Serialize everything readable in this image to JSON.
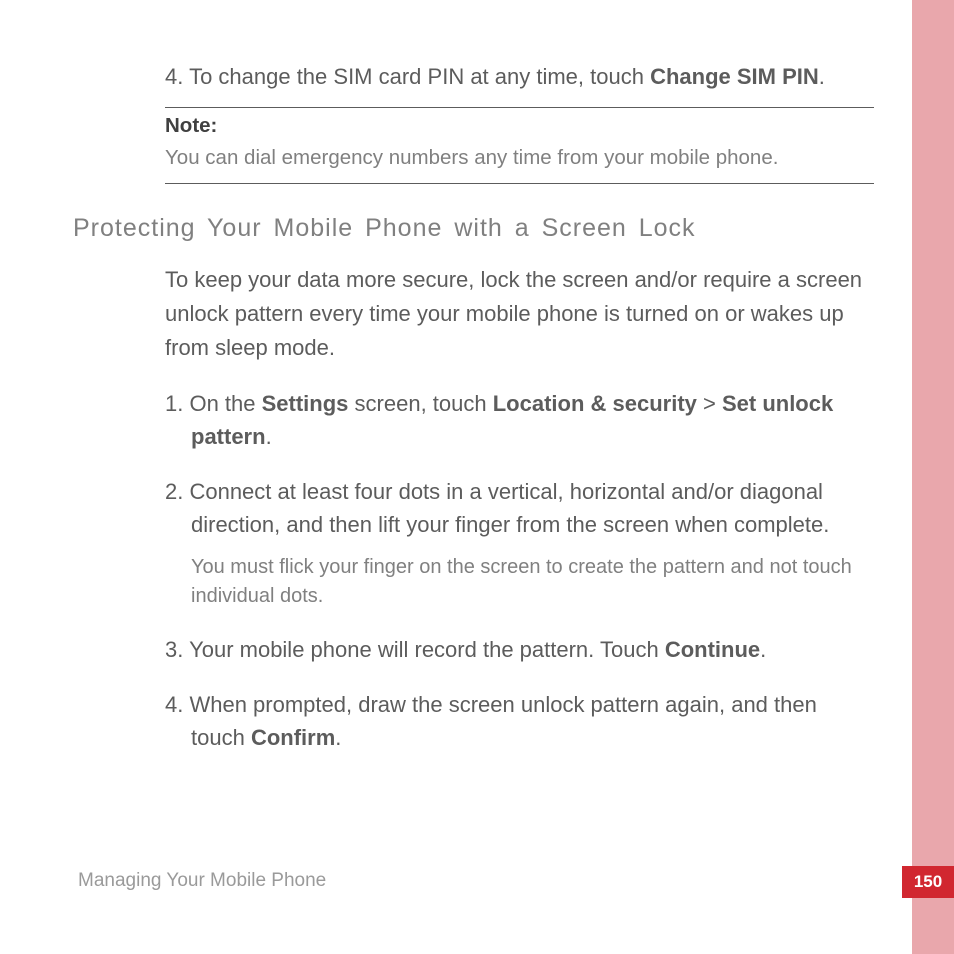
{
  "page": {
    "footer": "Managing Your Mobile Phone",
    "pageNumber": "150"
  },
  "topSection": {
    "step4_prefix": "4. To change the SIM card PIN at any time, touch ",
    "step4_bold": "Change SIM PIN",
    "step4_suffix": "."
  },
  "note": {
    "label": "Note:",
    "text": "You can dial emergency numbers any time from your mobile phone."
  },
  "section": {
    "heading": "Protecting Your Mobile Phone with a Screen Lock",
    "intro": "To keep your data more secure, lock the screen and/or require a screen unlock pattern every time your mobile phone is turned on or wakes up from sleep mode.",
    "step1": {
      "p1": "1. On the ",
      "b1": "Settings",
      "p2": " screen, touch ",
      "b2": "Location & security",
      "p3": " > ",
      "b3": "Set unlock pattern",
      "p4": "."
    },
    "step2": {
      "text": "2. Connect at least four dots in a vertical, horizontal and/or diagonal direction, and then lift your finger from the screen when complete.",
      "subnote": "You must flick your finger on the screen to create the pattern and not touch individual dots."
    },
    "step3": {
      "p1": "3. Your mobile phone will record the pattern. Touch ",
      "b1": "Continue",
      "p2": "."
    },
    "step4": {
      "p1": "4. When prompted, draw the screen unlock pattern again, and then touch ",
      "b1": "Confirm",
      "p2": "."
    }
  }
}
